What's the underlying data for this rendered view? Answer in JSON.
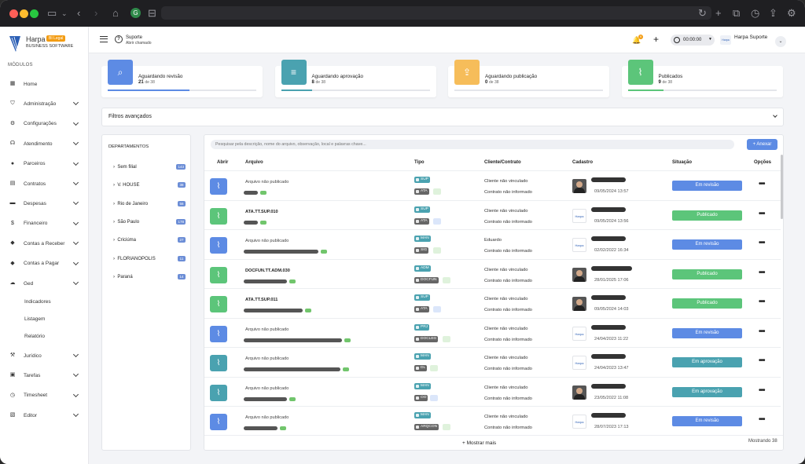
{
  "colors": {
    "accent": "#5d8be4",
    "revisao": "#5d8be4",
    "aprovacao": "#4aa2b0",
    "publicacao": "#f6bd5a",
    "publicado": "#5cc57a"
  },
  "brand": {
    "name": "Harpa",
    "badge": "BI Legal",
    "sub": "BUSINESS SOFTWARE"
  },
  "sidebar": {
    "section": "MÓDULOS",
    "items": [
      {
        "label": "Home",
        "icon": "grid-icon"
      },
      {
        "label": "Administração",
        "icon": "shield-icon"
      },
      {
        "label": "Configurações",
        "icon": "gear-icon"
      },
      {
        "label": "Atendimento",
        "icon": "headset-icon"
      },
      {
        "label": "Parceiros",
        "icon": "user-icon"
      },
      {
        "label": "Contratos",
        "icon": "file-icon"
      },
      {
        "label": "Despesas",
        "icon": "cash-icon"
      },
      {
        "label": "Financeiro",
        "icon": "dollar-icon"
      },
      {
        "label": "Contas a Receber",
        "icon": "tag-icon"
      },
      {
        "label": "Contas a Pagar",
        "icon": "tag-icon"
      },
      {
        "label": "Ged",
        "icon": "cloud-icon"
      }
    ],
    "ged_sub": [
      "Indicadores",
      "Listagem",
      "Relatório"
    ],
    "items2": [
      {
        "label": "Jurídico",
        "icon": "gavel-icon"
      },
      {
        "label": "Tarefas",
        "icon": "car-icon"
      },
      {
        "label": "Timesheet",
        "icon": "clock-icon"
      },
      {
        "label": "Editor",
        "icon": "doc-icon"
      }
    ]
  },
  "topbar": {
    "support_title": "Suporte",
    "support_sub": "Abrir chamado",
    "notif_count": "9",
    "timer": "00:00:00",
    "user": "Harpa Suporte"
  },
  "cards": [
    {
      "label": "Aguardando revisão",
      "count": "21",
      "of": "de 38",
      "icon": "search-icon",
      "fill": 0.55
    },
    {
      "label": "Aguardando aprovação",
      "count": "8",
      "of": "de 38",
      "icon": "list-check-icon",
      "fill": 0.21
    },
    {
      "label": "Aguardando publicação",
      "count": "0",
      "of": "de 38",
      "icon": "upload-icon",
      "fill": 0
    },
    {
      "label": "Publicados",
      "count": "9",
      "of": "de 38",
      "icon": "paperclip-icon",
      "fill": 0.24
    }
  ],
  "filters_label": "Filtros avançados",
  "departments": {
    "title": "DEPARTAMENTOS",
    "items": [
      {
        "name": "Sem filial",
        "count": "143"
      },
      {
        "name": "V. HOUSE",
        "count": "38"
      },
      {
        "name": "Rio de Janeiro",
        "count": "56"
      },
      {
        "name": "São Paulo",
        "count": "178"
      },
      {
        "name": "Criciúma",
        "count": "27"
      },
      {
        "name": "FLORIANOPOLIS",
        "count": "11"
      },
      {
        "name": "Paraná",
        "count": "14"
      }
    ]
  },
  "search_placeholder": "Pesquisar pela descrição, nome do arquivo, observação, local e palavras chave...",
  "add_label": "+ Anexar",
  "columns": [
    "Abrir",
    "Arquivo",
    "Tipo",
    "Cliente/Contrato",
    "Cadastro",
    "Situação",
    "Opções"
  ],
  "rows": [
    {
      "arquivo": "Arquivo não publicado",
      "tag1": "SUP",
      "tag2": "ATA",
      "cliente": "Cliente não vinculado",
      "contrato": "Contrato não informado",
      "data": "09/05/2024 13:57",
      "status": "Em revisão",
      "kind": "revisao"
    },
    {
      "arquivo": "ATA.TT.SUP.010",
      "tag1": "SUP",
      "tag2": "ATA",
      "cliente": "Cliente não vinculado",
      "contrato": "Contrato não informado",
      "data": "09/05/2024 13:56",
      "status": "Publicado",
      "kind": "publicado"
    },
    {
      "arquivo": "Arquivo não publicado",
      "tag1": "MAN",
      "tag2": "SIG",
      "cliente": "Eduardo",
      "contrato": "Contrato não informado",
      "data": "02/02/2022 16:34",
      "status": "Em revisão",
      "kind": "revisao"
    },
    {
      "arquivo": "DOCFUN.TT.ADM.030",
      "tag1": "ADM",
      "tag2": "DOCFUN",
      "cliente": "Cliente não vinculado",
      "contrato": "Contrato não informado",
      "data": "28/01/2025 17:06",
      "status": "Publicado",
      "kind": "publicado"
    },
    {
      "arquivo": "ATA.TT.SUP.011",
      "tag1": "SUP",
      "tag2": "ATA",
      "cliente": "Cliente não vinculado",
      "contrato": "Contrato não informado",
      "data": "09/05/2024 14:03",
      "status": "Publicado",
      "kind": "publicado"
    },
    {
      "arquivo": "Arquivo não publicado",
      "tag1": "PRJ",
      "tag2": "DOCLEG",
      "cliente": "Cliente não vinculado",
      "contrato": "Contrato não informado",
      "data": "24/04/2023 11:22",
      "status": "Em revisão",
      "kind": "revisao"
    },
    {
      "arquivo": "Arquivo não publicado",
      "tag1": "MAN",
      "tag2": "DL",
      "cliente": "Cliente não vinculado",
      "contrato": "Contrato não informado",
      "data": "24/04/2023 13:47",
      "status": "Em aprovação",
      "kind": "aprovacao"
    },
    {
      "arquivo": "Arquivo não publicado",
      "tag1": "MAN",
      "tag2": "OO",
      "cliente": "Cliente não vinculado",
      "contrato": "Contrato não informado",
      "data": "23/05/2022 11:08",
      "status": "Em aprovação",
      "kind": "aprovacao"
    },
    {
      "arquivo": "Arquivo não publicado",
      "tag1": "MAN",
      "tag2": "ARQCON",
      "cliente": "Cliente não vinculado",
      "contrato": "Contrato não informado",
      "data": "28/07/2023 17:13",
      "status": "Em revisão",
      "kind": "revisao"
    }
  ],
  "show_more": "+ Mostrar mais",
  "showing": "Mostrando 38"
}
